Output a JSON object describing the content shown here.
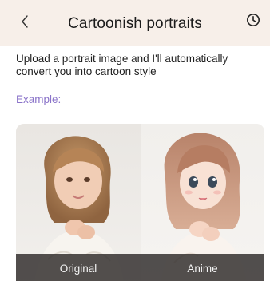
{
  "header": {
    "title": "Cartoonish portraits",
    "back_icon": "chevron-left-icon",
    "history_icon": "clock-icon"
  },
  "description": "Upload a portrait image and I'll automatically convert you into cartoon style",
  "example": {
    "label": "Example:",
    "original_label": "Original",
    "anime_label": "Anime"
  },
  "colors": {
    "header_bg": "#f7efe9",
    "accent": "#8a73c9",
    "caption_bar": "#2d2a28"
  }
}
